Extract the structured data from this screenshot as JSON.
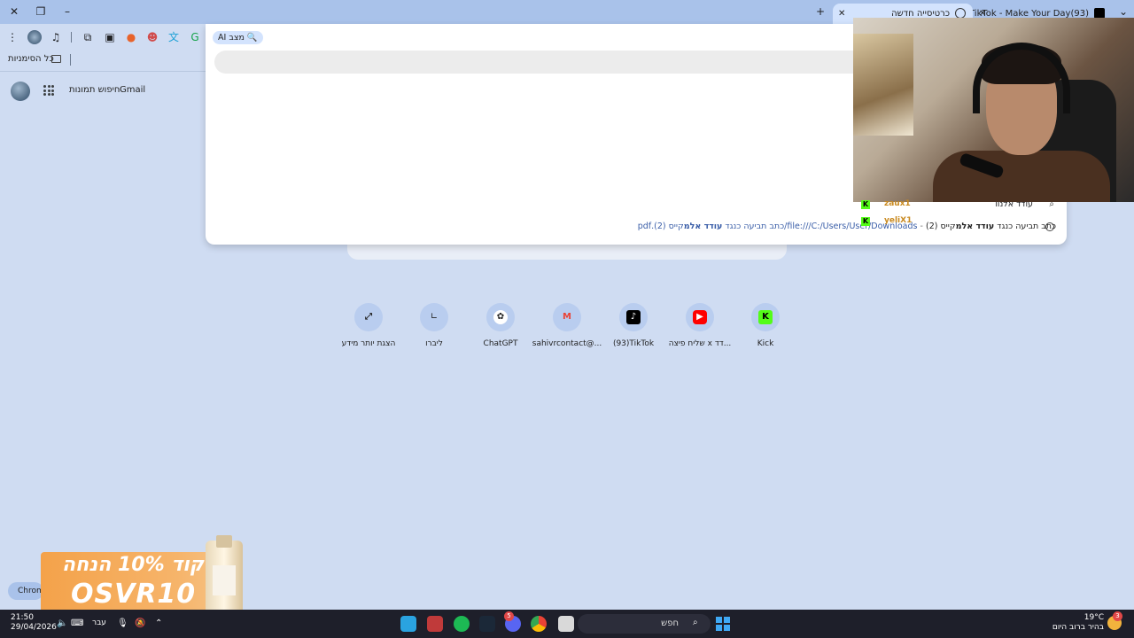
{
  "window": {
    "tabs": [
      {
        "label": "(93)TikTok - Make Your Day",
        "active": false
      },
      {
        "label": "כרטיסייה חדשה",
        "active": true
      }
    ],
    "new_tab_label": "+"
  },
  "toolbar": {
    "bookmarks_all": "כל הסימניות"
  },
  "google_top": {
    "gmail": "Gmail",
    "image_search": "חיפוש תמונות"
  },
  "omnibox": {
    "ai_mode": "מצב AI",
    "input_value": "",
    "suggestion_1": "עודד אלנוו",
    "suggestion_2_prefix": "כתב תביעה כנגד ",
    "suggestion_2_bold": "עודד אלמ",
    "suggestion_2_suffix": "קייס (2)",
    "suggestion_2_url_prefix": "file:///C:/Users/User/Downloads/כתב תביעה כנגד ",
    "suggestion_2_url_bold": "עודד אלמ",
    "suggestion_2_url_suffix": "קייס (2).pdf"
  },
  "chat_overlay": {
    "names": [
      "zaux1",
      "yeliX1"
    ]
  },
  "shortcuts": [
    {
      "label": "Kick",
      "icon": "kick-icon",
      "color": "#53fc18"
    },
    {
      "label": "שליח פיצה x דד...",
      "icon": "youtube-icon",
      "color": "#ff0000"
    },
    {
      "label": "(93)TikTok",
      "icon": "tiktok-icon",
      "color": "#000000"
    },
    {
      "label": "sahivrcontact@...",
      "icon": "gmail-icon",
      "color": "#ea4335"
    },
    {
      "label": "ChatGPT",
      "icon": "chatgpt-icon",
      "color": "#ffffff"
    },
    {
      "label": "ליברו",
      "icon": "libro-icon",
      "color": "#1f1f1f"
    },
    {
      "label": "הצגת יותר מידע",
      "icon": "expand-icon",
      "color": "#1f1f1f"
    }
  ],
  "promo": {
    "line1": "קוד 10% הנחה",
    "line2": "OSVR10"
  },
  "chrome_pill": "Chrom",
  "taskbar": {
    "time": "21:50",
    "date": "29/04/2026",
    "lang": "עבר",
    "search_placeholder": "חפש",
    "weather_temp": "19°C",
    "weather_desc": "בהיר ברוב היום",
    "weather_badge": "3",
    "discord_badge": "5"
  }
}
